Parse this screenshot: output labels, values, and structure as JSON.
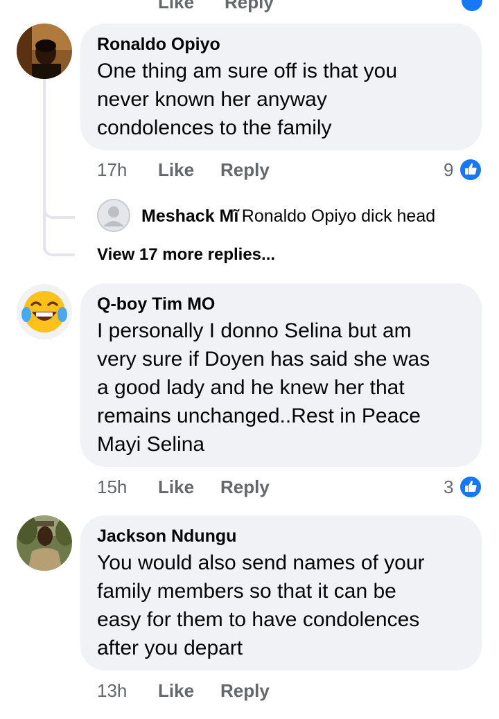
{
  "top_row": {
    "like_label": "Like",
    "reply_label": "Reply"
  },
  "comments": [
    {
      "author": "Ronaldo Opiyo",
      "lines": [
        "One thing am sure off is that you",
        "never known her anyway",
        "condolences to the family"
      ],
      "time": "17h",
      "like_label": "Like",
      "reply_label": "Reply",
      "reaction_count": "9",
      "reaction_icon": "thumbs-up-icon",
      "avatar_icon": "photo-avatar",
      "reply": {
        "author": "Meshack Mĩ",
        "text": "Ronaldo Opiyo dick head",
        "avatar_icon": "default-user-icon"
      },
      "view_more": "View 17 more replies..."
    },
    {
      "author": "Q-boy Tim MO",
      "lines": [
        "I personally I donno Selina but am",
        "very sure if Doyen has said she was",
        "a good lady and he knew her that",
        "remains unchanged..Rest in Peace",
        "Mayi Selina"
      ],
      "time": "15h",
      "like_label": "Like",
      "reply_label": "Reply",
      "reaction_count": "3",
      "reaction_icon": "thumbs-up-icon",
      "avatar_icon": "laughing-crying-emoji"
    },
    {
      "author": "Jackson Ndungu",
      "lines": [
        "You would also send names of your",
        "family members so that it can be",
        "easy for them to have condolences",
        "after you depart"
      ],
      "time": "13h",
      "like_label": "Like",
      "reply_label": "Reply",
      "avatar_icon": "photo-avatar"
    }
  ],
  "colors": {
    "bubble": "#f0f2f5",
    "meta_text": "#65676b",
    "like_blue": "#1877f2",
    "thread_line": "#e4e6eb"
  }
}
